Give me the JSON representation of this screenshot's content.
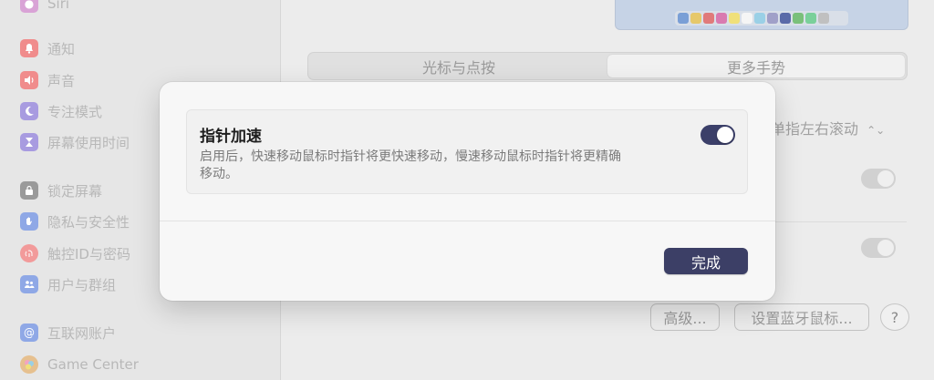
{
  "sidebar": {
    "items": [
      {
        "label": "Siri",
        "icon": "siri-icon",
        "color": "#d9a3d6"
      },
      {
        "label": "通知",
        "icon": "bell-icon",
        "color": "#f08c8c"
      },
      {
        "label": "声音",
        "icon": "speaker-icon",
        "color": "#f08c8c"
      },
      {
        "label": "专注模式",
        "icon": "moon-icon",
        "color": "#a89be0"
      },
      {
        "label": "屏幕使用时间",
        "icon": "hourglass-icon",
        "color": "#a89be0"
      },
      {
        "label": "锁定屏幕",
        "icon": "lock-icon",
        "color": "#9a9a9a"
      },
      {
        "label": "隐私与安全性",
        "icon": "hand-icon",
        "color": "#8fa8e6"
      },
      {
        "label": "触控ID与密码",
        "icon": "fingerprint-icon",
        "color": "#f29a9a"
      },
      {
        "label": "用户与群组",
        "icon": "users-icon",
        "color": "#8fa8e6"
      },
      {
        "label": "互联网账户",
        "icon": "at-icon",
        "color": "#8fa8e6"
      },
      {
        "label": "Game Center",
        "icon": "game-center-icon",
        "color": "#e6c08f"
      }
    ]
  },
  "main": {
    "tabs": [
      {
        "label": "光标与点按",
        "active": false
      },
      {
        "label": "更多手势",
        "active": true
      }
    ],
    "popup_value": "单指左右滚动",
    "buttons": {
      "advanced": "高级...",
      "bluetooth": "设置蓝牙鼠标...",
      "help": "?"
    },
    "dock_colors": [
      "#7a9fd6",
      "#e6c86a",
      "#e07a7a",
      "#d97ab0",
      "#f0e07a",
      "#f5f5f5",
      "#9ad0e6",
      "#a0a0c8",
      "#5a6aa8",
      "#7ac07a",
      "#7ad09a",
      "#c0c0c0"
    ]
  },
  "dialog": {
    "setting_title": "指针加速",
    "setting_description": "启用后，快速移动鼠标时指针将更快速移动，慢速移动鼠标时指针将更精确移动。",
    "toggle_on": true,
    "done_label": "完成",
    "accent_color": "#3c3f66"
  }
}
